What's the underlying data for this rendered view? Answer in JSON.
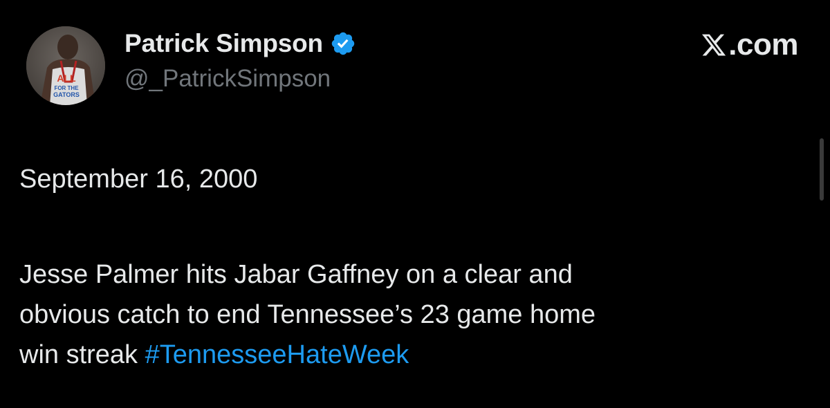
{
  "user": {
    "display_name": "Patrick Simpson",
    "handle": "@_PatrickSimpson",
    "verified": true,
    "avatar_icon": "avatar-photo",
    "avatar_shirt_text": [
      "ALL",
      "FOR THE",
      "GATORS"
    ]
  },
  "brand": {
    "logo_icon": "x-logo-icon",
    "text": ".com"
  },
  "tweet": {
    "date_line": "September 16, 2000",
    "body_lines": [
      "Jesse Palmer hits Jabar Gaffney on a clear and",
      "obvious catch to end Tennessee’s 23 game home"
    ],
    "body_last_prefix": "win streak ",
    "hashtag": "#TennesseeHateWeek"
  },
  "colors": {
    "background": "#000000",
    "text_primary": "#e7e9ea",
    "text_secondary": "#71767b",
    "link": "#1d9bf0",
    "verified_badge": "#1d9bf0"
  }
}
